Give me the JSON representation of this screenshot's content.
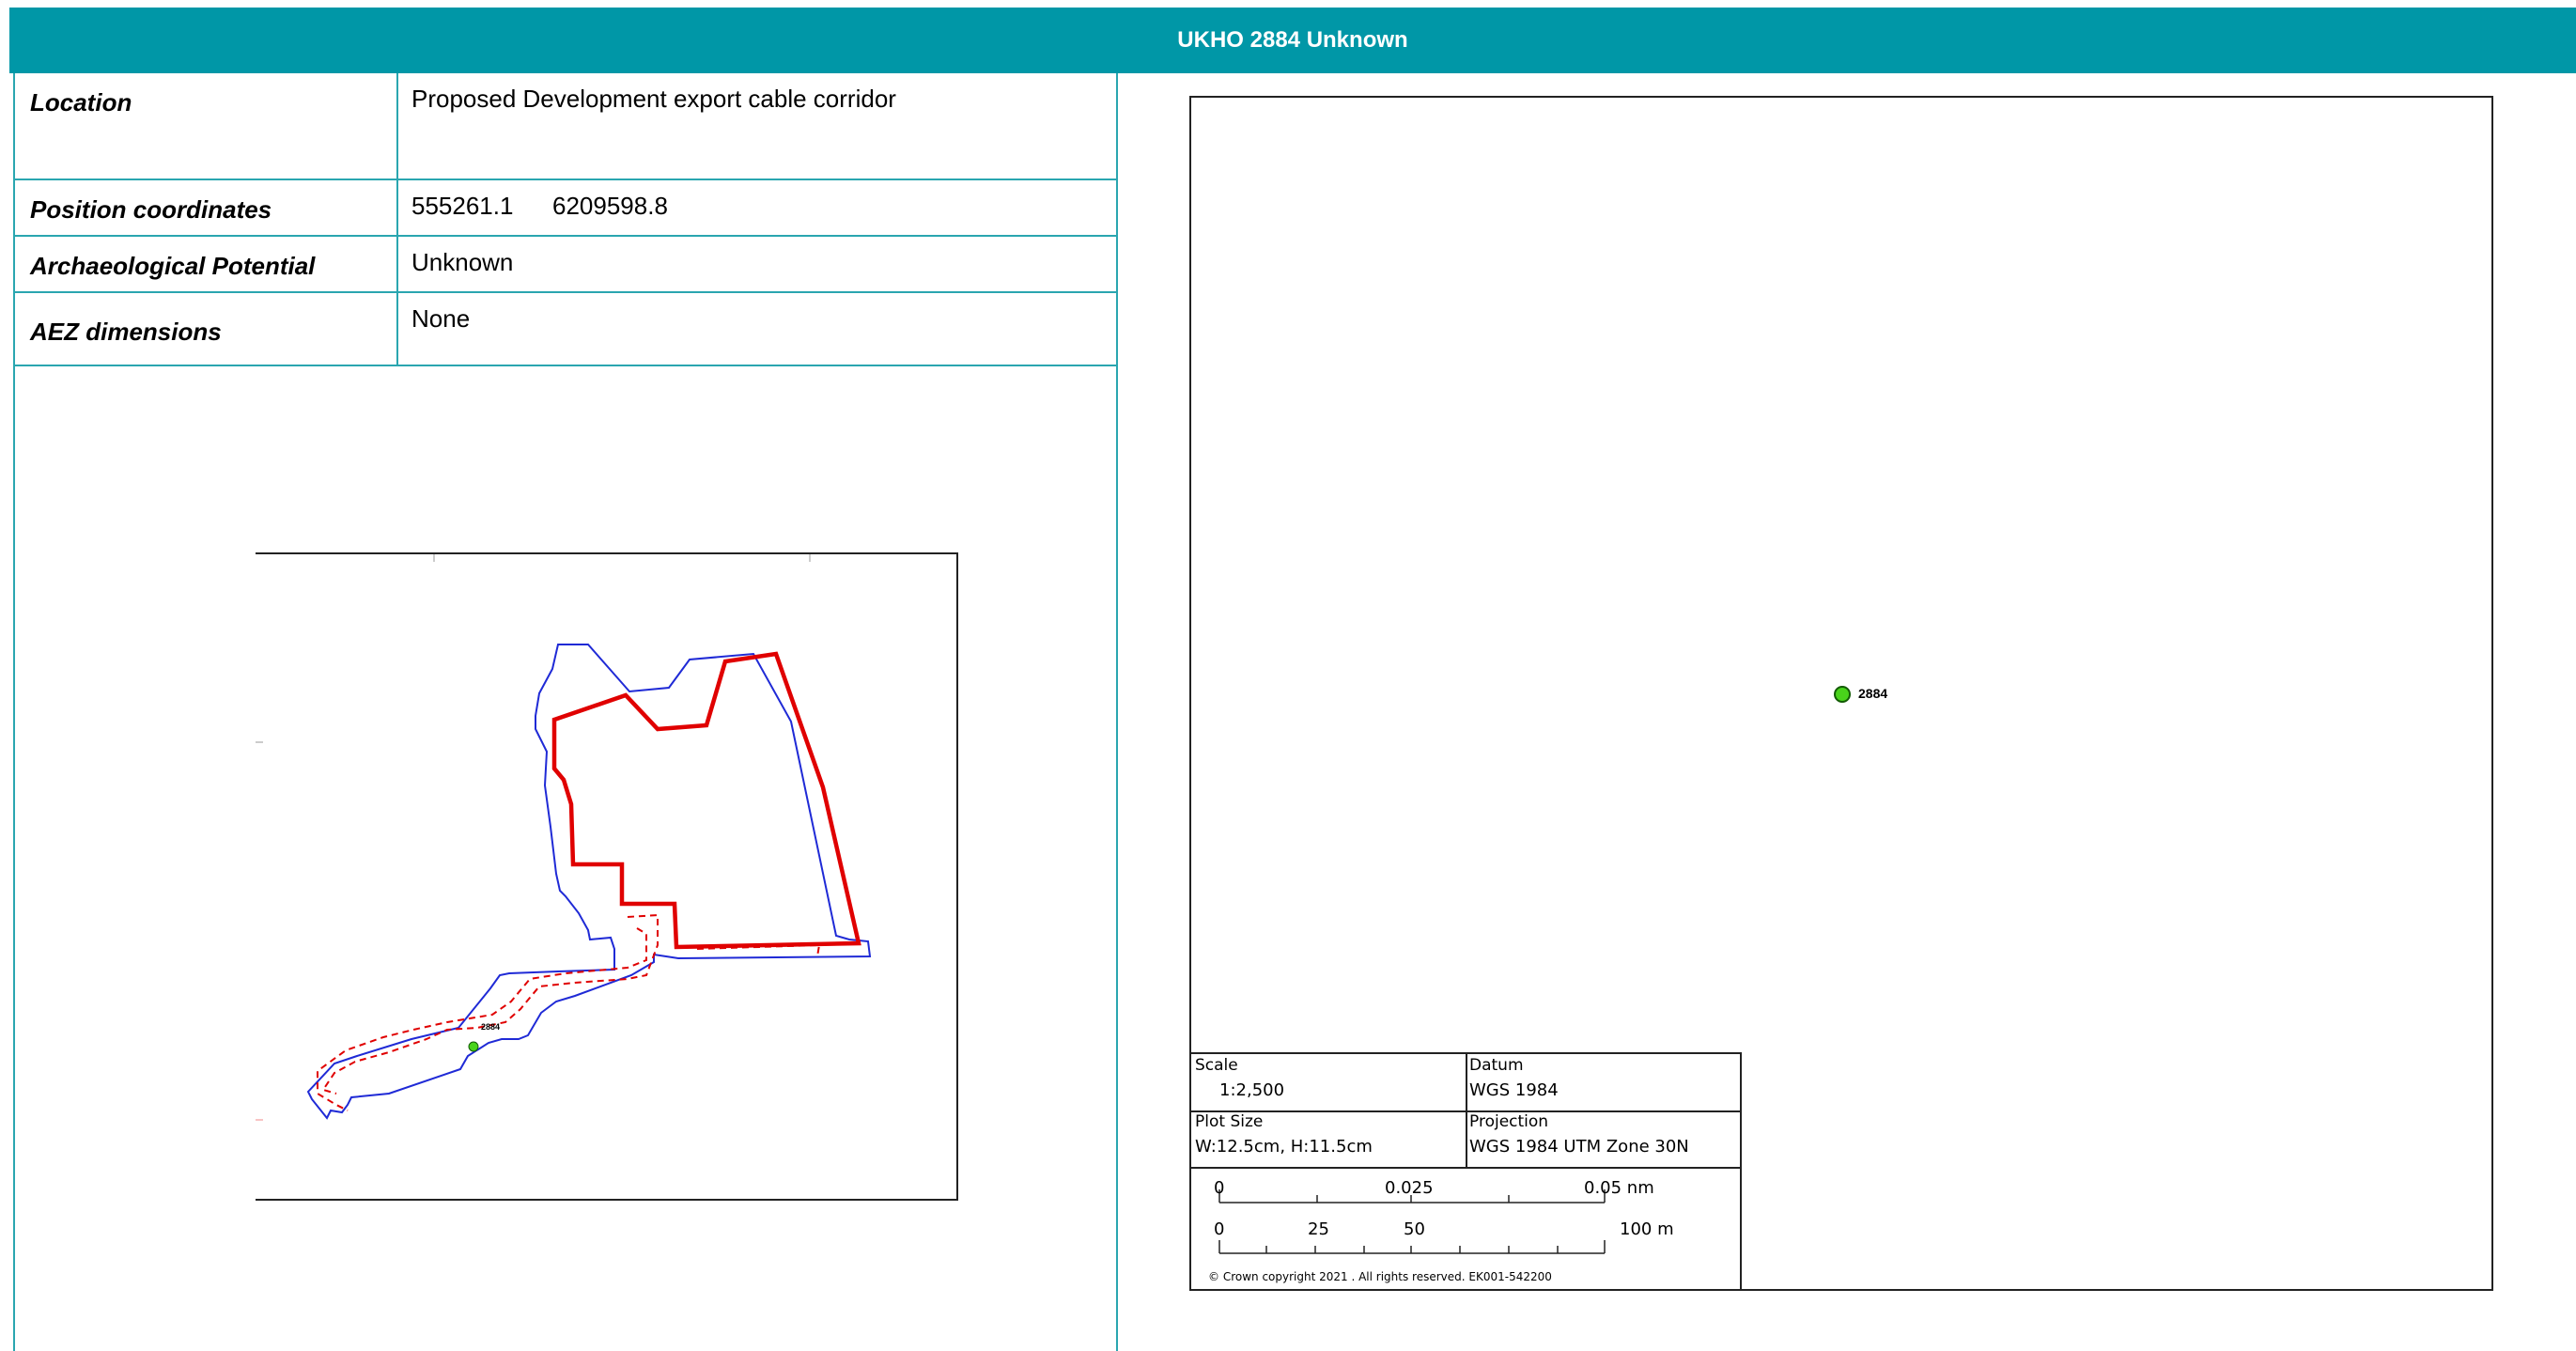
{
  "header": {
    "title": "UKHO 2884 Unknown"
  },
  "details": {
    "location_label": "Location",
    "location_value": "Proposed Development export cable corridor",
    "position_label": "Position coordinates",
    "position_easting": "555261.1",
    "position_northing": "6209598.8",
    "potential_label": "Archaeological Potential",
    "potential_value": "Unknown",
    "aez_label": "AEZ dimensions",
    "aez_value": "None"
  },
  "minimap": {
    "marker_label": "2884",
    "colors": {
      "boundary": "#e00000",
      "buffer": "#1f2ad6",
      "marker": "#49d31b"
    }
  },
  "map": {
    "marker_label": "2884",
    "legend": {
      "scale_label": "Scale",
      "scale_value": "1:2,500",
      "datum_label": "Datum",
      "datum_value": "WGS 1984",
      "plot_size_label": "Plot Size",
      "plot_size_value": "W:12.5cm, H:11.5cm",
      "projection_label": "Projection",
      "projection_value": "WGS 1984 UTM Zone 30N",
      "nm_ticks": [
        "0",
        "0.025",
        "0.05 nm"
      ],
      "m_ticks": [
        "0",
        "25",
        "50",
        "100 m"
      ],
      "copyright": "© Crown copyright 2021 . All rights reserved. EK001-542200"
    }
  },
  "colors": {
    "header": "#0097a7",
    "table_border": "#2aa6b0"
  }
}
